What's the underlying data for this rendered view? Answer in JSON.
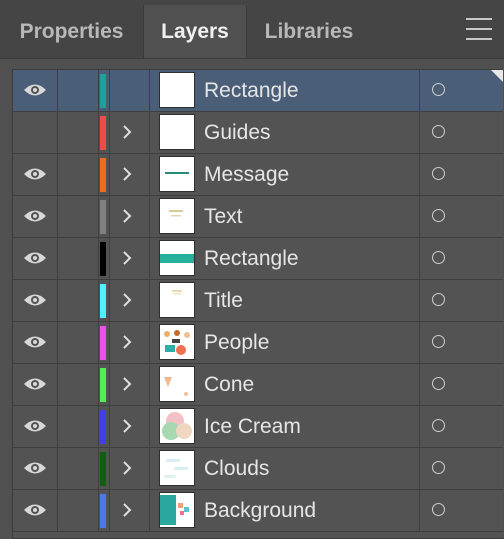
{
  "tabs": [
    {
      "label": "Properties",
      "active": false
    },
    {
      "label": "Layers",
      "active": true
    },
    {
      "label": "Libraries",
      "active": false
    }
  ],
  "menu_icon": "hamburger-menu-icon",
  "layers": [
    {
      "name": "Rectangle",
      "visible": true,
      "color": "#1aa39a",
      "expandable": false,
      "selected": true,
      "thumb": "blank"
    },
    {
      "name": "Guides",
      "visible": false,
      "color": "#ee4b4b",
      "expandable": true,
      "selected": false,
      "thumb": "blank"
    },
    {
      "name": "Message",
      "visible": true,
      "color": "#f26a1c",
      "expandable": true,
      "selected": false,
      "thumb": "message"
    },
    {
      "name": "Text",
      "visible": true,
      "color": "#808080",
      "expandable": true,
      "selected": false,
      "thumb": "text"
    },
    {
      "name": "Rectangle",
      "visible": true,
      "color": "#000000",
      "expandable": true,
      "selected": false,
      "thumb": "band"
    },
    {
      "name": "Title",
      "visible": true,
      "color": "#4ff0ff",
      "expandable": true,
      "selected": false,
      "thumb": "title"
    },
    {
      "name": "People",
      "visible": true,
      "color": "#f04ff0",
      "expandable": true,
      "selected": false,
      "thumb": "people"
    },
    {
      "name": "Cone",
      "visible": true,
      "color": "#4ff04f",
      "expandable": true,
      "selected": false,
      "thumb": "cone"
    },
    {
      "name": "Ice Cream",
      "visible": true,
      "color": "#4040e8",
      "expandable": true,
      "selected": false,
      "thumb": "icecream"
    },
    {
      "name": "Clouds",
      "visible": true,
      "color": "#105e10",
      "expandable": true,
      "selected": false,
      "thumb": "clouds"
    },
    {
      "name": "Background",
      "visible": true,
      "color": "#4a78e8",
      "expandable": true,
      "selected": false,
      "thumb": "background"
    }
  ]
}
